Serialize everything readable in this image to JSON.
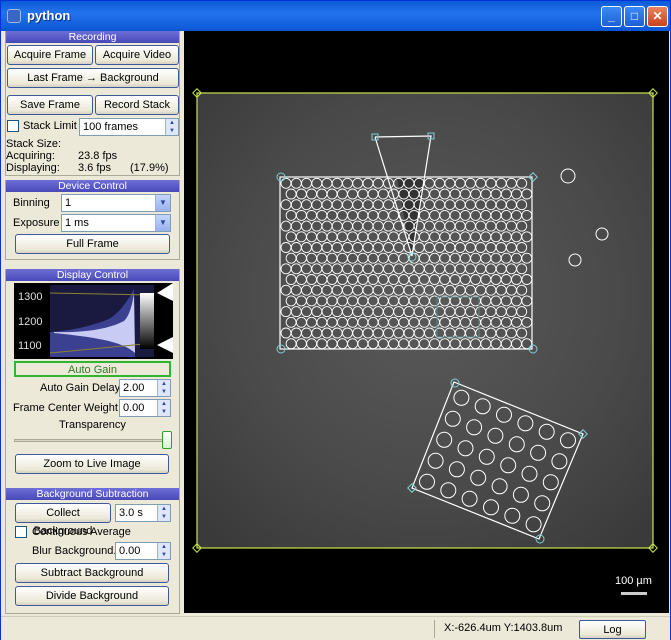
{
  "window": {
    "title": "python"
  },
  "recording": {
    "header": "Recording",
    "acquire_frame": "Acquire Frame",
    "acquire_video": "Acquire Video",
    "last_frame_bg": "Last Frame → Background",
    "save_frame": "Save Frame",
    "record_stack": "Record Stack",
    "stack_limit_label": "Stack Limit",
    "stack_limit_value": "100 frames",
    "stack_size_label": "Stack Size:",
    "acquiring_label": "Acquiring:",
    "acquiring_value": "23.8 fps",
    "displaying_label": "Displaying:",
    "displaying_value": "3.6 fps",
    "displaying_pct": "(17.9%)"
  },
  "device": {
    "header": "Device Control",
    "binning_label": "Binning",
    "binning_value": "1",
    "exposure_label": "Exposure",
    "exposure_value": "1 ms",
    "full_frame": "Full Frame"
  },
  "display": {
    "header": "Display Control",
    "hist_ticks": [
      "1300",
      "1200",
      "1100"
    ],
    "auto_gain": "Auto Gain",
    "auto_gain_delay_label": "Auto Gain Delay",
    "auto_gain_delay_value": "2.00",
    "frame_center_weight_label": "Frame Center Weight",
    "frame_center_weight_value": "0.00",
    "transparency_label": "Transparency",
    "transparency_level": 1.0,
    "zoom_live": "Zoom to Live Image"
  },
  "background": {
    "header": "Background Subtraction",
    "collect": "Collect Background",
    "collect_time": "3.0 s",
    "continuous_avg": "Continuous Average",
    "blur_label": "Blur Background.",
    "blur_value": "0.00",
    "subtract": "Subtract Background",
    "divide": "Divide Background"
  },
  "viewport": {
    "scale_bar_label": "100 µm",
    "roi_color": "#c8e64a",
    "overlay_color": "#ffffff",
    "handle_color": "#7fd0d8"
  },
  "status": {
    "coords": "X:-626.4um Y:1403.8um",
    "log": "Log"
  },
  "colors": {
    "accent": "#4848b8",
    "auto_gain_border": "#2fb52f"
  }
}
